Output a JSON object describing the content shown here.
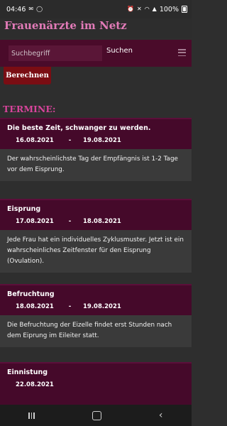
{
  "statusbar": {
    "time": "04:46",
    "battery": "100%",
    "icons": [
      "email-icon",
      "whatsapp-icon",
      "alarm-icon",
      "mute-icon",
      "wifi-icon",
      "signal-icon",
      "battery-icon"
    ]
  },
  "header": {
    "title": "Frauenärzte im Netz"
  },
  "search": {
    "placeholder": "Suchbegriff",
    "button": "Suchen"
  },
  "calc_button": "Berechnen",
  "termine_heading": "TERMINE:",
  "cards": [
    {
      "title": "Die beste Zeit, schwanger zu werden.",
      "from": "16.08.2021",
      "sep": "-",
      "to": "19.08.2021",
      "text": "Der wahrscheinlichste Tag der Empfängnis ist 1-2 Tage vor dem Eisprung."
    },
    {
      "title": "Eisprung",
      "from": "17.08.2021",
      "sep": "-",
      "to": "18.08.2021",
      "text": "Jede Frau hat ein individuelles Zyklusmuster. Jetzt ist ein wahrscheinliches Zeitfenster für den Eisprung (Ovulation)."
    },
    {
      "title": "Befruchtung",
      "from": "18.08.2021",
      "sep": "-",
      "to": "19.08.2021",
      "text": "Die Befruchtung der Eizelle findet erst Stunden nach dem Eiprung im Eileiter statt."
    },
    {
      "title": "Einnistung",
      "from": "22.08.2021",
      "sep": "",
      "to": "",
      "text": ""
    }
  ],
  "colors": {
    "accent": "#d7449b",
    "title": "#e27bb8",
    "card_header": "#45092a",
    "button": "#7a0d13"
  }
}
